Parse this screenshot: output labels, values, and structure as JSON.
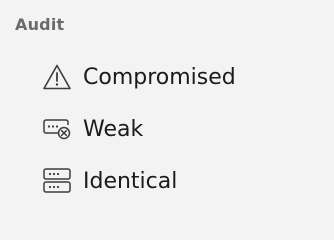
{
  "section": {
    "title": "Audit"
  },
  "items": [
    {
      "label": "Compromised",
      "icon": "warning-triangle-icon"
    },
    {
      "label": "Weak",
      "icon": "weak-password-icon"
    },
    {
      "label": "Identical",
      "icon": "identical-passwords-icon"
    }
  ],
  "colors": {
    "background": "#f3f3f3",
    "header_text": "#6b6b6b",
    "item_text": "#1b1b1b",
    "icon_stroke": "#3c3c3c"
  }
}
